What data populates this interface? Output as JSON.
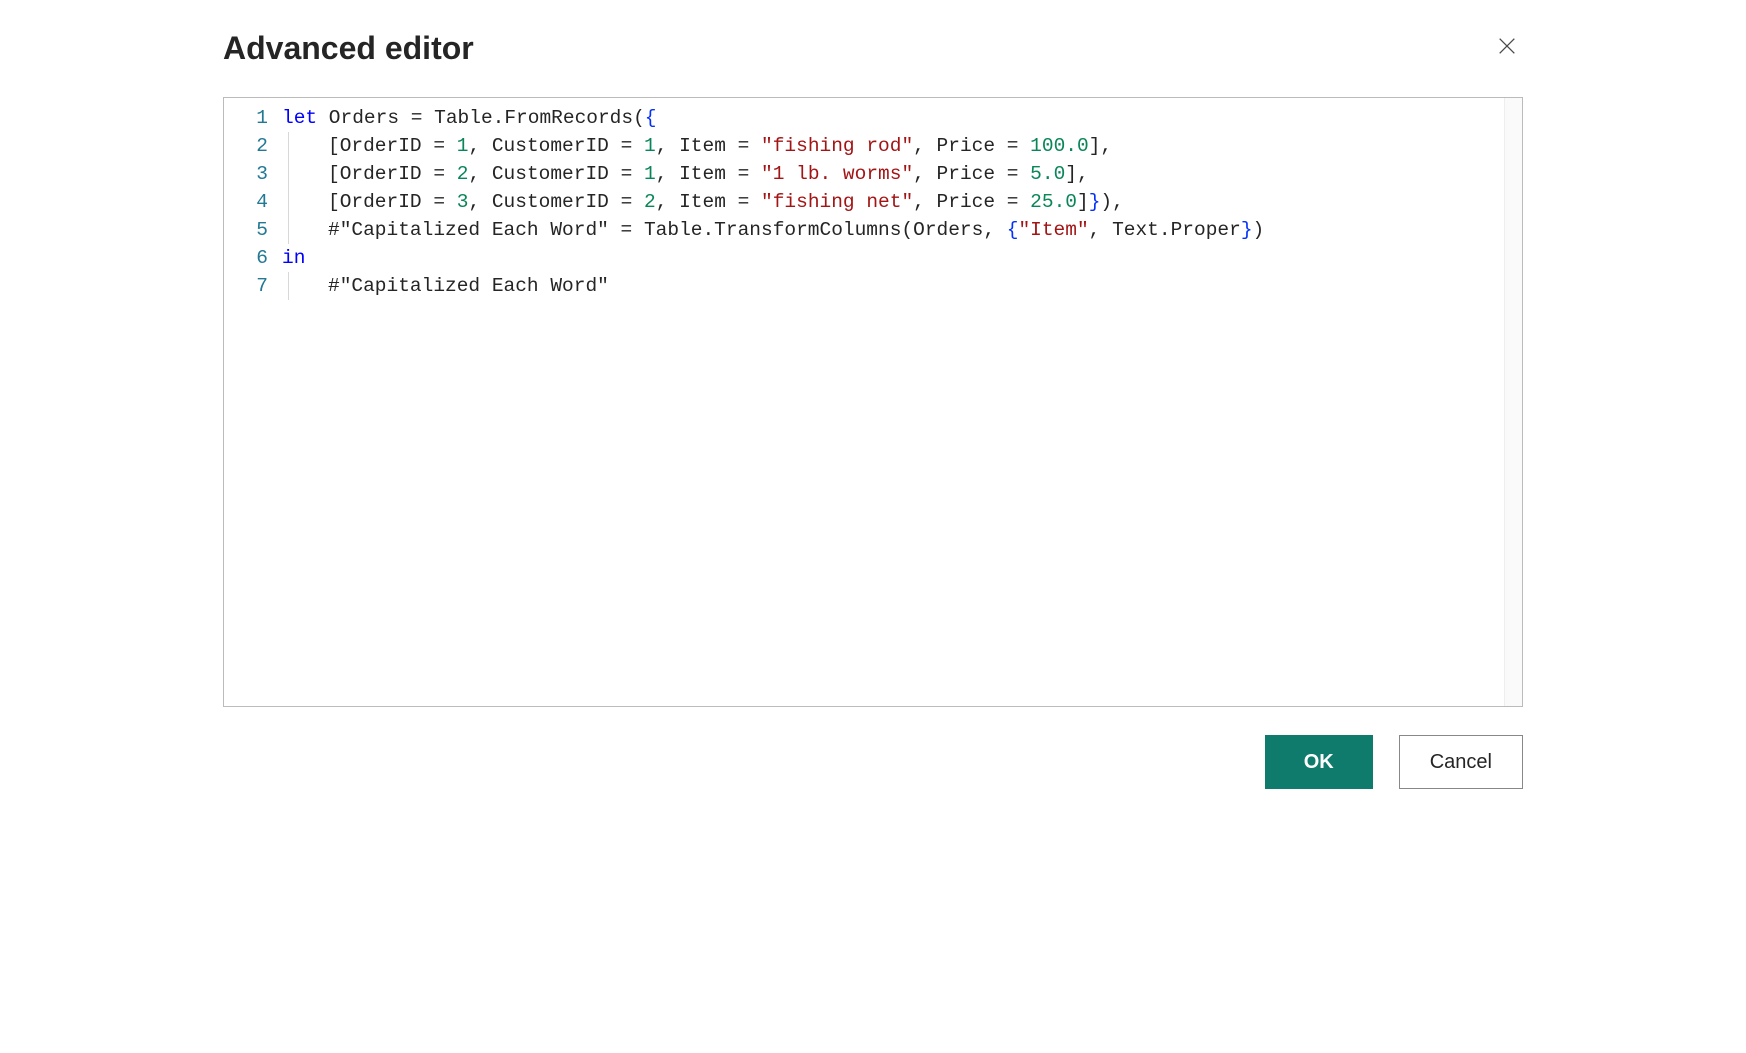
{
  "dialog": {
    "title": "Advanced editor",
    "ok_label": "OK",
    "cancel_label": "Cancel"
  },
  "editor": {
    "line_numbers": [
      "1",
      "2",
      "3",
      "4",
      "5",
      "6",
      "7"
    ],
    "lines": [
      {
        "indent": 0,
        "hasGuide": false,
        "tokens": [
          {
            "t": "keyword",
            "v": "let"
          },
          {
            "t": "ident",
            "v": " Orders "
          },
          {
            "t": "op",
            "v": "= "
          },
          {
            "t": "ident",
            "v": "Table.FromRecords"
          },
          {
            "t": "paren",
            "v": "("
          },
          {
            "t": "brace",
            "v": "{"
          }
        ]
      },
      {
        "indent": 1,
        "hasGuide": true,
        "tokens": [
          {
            "t": "bracket",
            "v": "["
          },
          {
            "t": "ident",
            "v": "OrderID "
          },
          {
            "t": "op",
            "v": "= "
          },
          {
            "t": "num",
            "v": "1"
          },
          {
            "t": "op",
            "v": ", "
          },
          {
            "t": "ident",
            "v": "CustomerID "
          },
          {
            "t": "op",
            "v": "= "
          },
          {
            "t": "num",
            "v": "1"
          },
          {
            "t": "op",
            "v": ", "
          },
          {
            "t": "ident",
            "v": "Item "
          },
          {
            "t": "op",
            "v": "= "
          },
          {
            "t": "str",
            "v": "\"fishing rod\""
          },
          {
            "t": "op",
            "v": ", "
          },
          {
            "t": "ident",
            "v": "Price "
          },
          {
            "t": "op",
            "v": "= "
          },
          {
            "t": "num",
            "v": "100.0"
          },
          {
            "t": "bracket",
            "v": "]"
          },
          {
            "t": "op",
            "v": ","
          }
        ]
      },
      {
        "indent": 1,
        "hasGuide": true,
        "tokens": [
          {
            "t": "bracket",
            "v": "["
          },
          {
            "t": "ident",
            "v": "OrderID "
          },
          {
            "t": "op",
            "v": "= "
          },
          {
            "t": "num",
            "v": "2"
          },
          {
            "t": "op",
            "v": ", "
          },
          {
            "t": "ident",
            "v": "CustomerID "
          },
          {
            "t": "op",
            "v": "= "
          },
          {
            "t": "num",
            "v": "1"
          },
          {
            "t": "op",
            "v": ", "
          },
          {
            "t": "ident",
            "v": "Item "
          },
          {
            "t": "op",
            "v": "= "
          },
          {
            "t": "str",
            "v": "\"1 lb. worms\""
          },
          {
            "t": "op",
            "v": ", "
          },
          {
            "t": "ident",
            "v": "Price "
          },
          {
            "t": "op",
            "v": "= "
          },
          {
            "t": "num",
            "v": "5.0"
          },
          {
            "t": "bracket",
            "v": "]"
          },
          {
            "t": "op",
            "v": ","
          }
        ]
      },
      {
        "indent": 1,
        "hasGuide": true,
        "tokens": [
          {
            "t": "bracket",
            "v": "["
          },
          {
            "t": "ident",
            "v": "OrderID "
          },
          {
            "t": "op",
            "v": "= "
          },
          {
            "t": "num",
            "v": "3"
          },
          {
            "t": "op",
            "v": ", "
          },
          {
            "t": "ident",
            "v": "CustomerID "
          },
          {
            "t": "op",
            "v": "= "
          },
          {
            "t": "num",
            "v": "2"
          },
          {
            "t": "op",
            "v": ", "
          },
          {
            "t": "ident",
            "v": "Item "
          },
          {
            "t": "op",
            "v": "= "
          },
          {
            "t": "str",
            "v": "\"fishing net\""
          },
          {
            "t": "op",
            "v": ", "
          },
          {
            "t": "ident",
            "v": "Price "
          },
          {
            "t": "op",
            "v": "= "
          },
          {
            "t": "num",
            "v": "25.0"
          },
          {
            "t": "bracket",
            "v": "]"
          },
          {
            "t": "brace",
            "v": "}"
          },
          {
            "t": "paren",
            "v": ")"
          },
          {
            "t": "op",
            "v": ","
          }
        ]
      },
      {
        "indent": 1,
        "hasGuide": true,
        "tokens": [
          {
            "t": "stepname",
            "v": "#\"Capitalized Each Word\""
          },
          {
            "t": "op",
            "v": " = "
          },
          {
            "t": "ident",
            "v": "Table.TransformColumns"
          },
          {
            "t": "paren",
            "v": "("
          },
          {
            "t": "ident",
            "v": "Orders"
          },
          {
            "t": "op",
            "v": ", "
          },
          {
            "t": "brace",
            "v": "{"
          },
          {
            "t": "str",
            "v": "\"Item\""
          },
          {
            "t": "op",
            "v": ", "
          },
          {
            "t": "ident",
            "v": "Text.Proper"
          },
          {
            "t": "brace",
            "v": "}"
          },
          {
            "t": "paren",
            "v": ")"
          }
        ]
      },
      {
        "indent": 0,
        "hasGuide": false,
        "tokens": [
          {
            "t": "keyword",
            "v": "in"
          }
        ]
      },
      {
        "indent": 1,
        "hasGuide": true,
        "tokens": [
          {
            "t": "stepname",
            "v": "#\"Capitalized Each Word\""
          }
        ]
      }
    ]
  }
}
